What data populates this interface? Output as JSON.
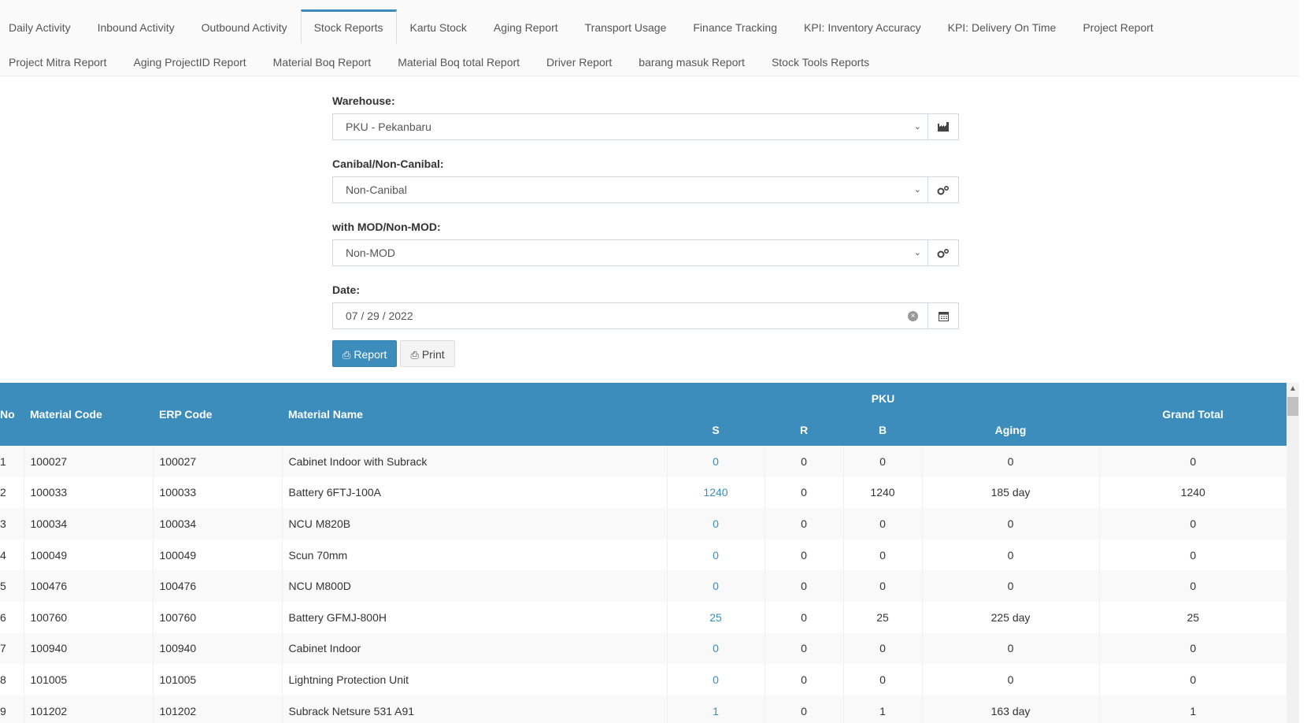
{
  "tabs": {
    "row1": [
      "Daily Activity",
      "Inbound Activity",
      "Outbound Activity",
      "Stock Reports",
      "Kartu Stock",
      "Aging Report",
      "Transport Usage",
      "Finance Tracking",
      "KPI: Inventory Accuracy",
      "KPI: Delivery On Time",
      "Project Report"
    ],
    "row2": [
      "Project Mitra Report",
      "Aging ProjectID Report",
      "Material Boq Report",
      "Material Boq total Report",
      "Driver Report",
      "barang masuk Report",
      "Stock Tools Reports"
    ],
    "active": "Stock Reports"
  },
  "form": {
    "warehouse": {
      "label": "Warehouse:",
      "value": "PKU - Pekanbaru",
      "icon": "industry-icon"
    },
    "canibal": {
      "label": "Canibal/Non-Canibal:",
      "value": "Non-Canibal",
      "icon": "gears-icon"
    },
    "mod": {
      "label": "with MOD/Non-MOD:",
      "value": "Non-MOD",
      "icon": "gears-icon"
    },
    "date": {
      "label": "Date:",
      "value": "07 / 29 / 2022",
      "icon": "calendar-icon"
    },
    "report_label": "Report",
    "print_label": "Print"
  },
  "table": {
    "headers": {
      "no": "No",
      "material_code": "Material Code",
      "erp_code": "ERP Code",
      "material_name": "Material Name",
      "group": "PKU",
      "s": "S",
      "r": "R",
      "b": "B",
      "aging": "Aging",
      "grand_total": "Grand Total"
    },
    "rows": [
      {
        "no": "1",
        "code": "100027",
        "erp": "100027",
        "name": "Cabinet Indoor with Subrack",
        "s": "0",
        "r": "0",
        "b": "0",
        "aging": "0",
        "total": "0"
      },
      {
        "no": "2",
        "code": "100033",
        "erp": "100033",
        "name": "Battery 6FTJ-100A",
        "s": "1240",
        "r": "0",
        "b": "1240",
        "aging": "185 day",
        "total": "1240"
      },
      {
        "no": "3",
        "code": "100034",
        "erp": "100034",
        "name": "NCU M820B",
        "s": "0",
        "r": "0",
        "b": "0",
        "aging": "0",
        "total": "0"
      },
      {
        "no": "4",
        "code": "100049",
        "erp": "100049",
        "name": "Scun 70mm",
        "s": "0",
        "r": "0",
        "b": "0",
        "aging": "0",
        "total": "0"
      },
      {
        "no": "5",
        "code": "100476",
        "erp": "100476",
        "name": "NCU M800D",
        "s": "0",
        "r": "0",
        "b": "0",
        "aging": "0",
        "total": "0"
      },
      {
        "no": "6",
        "code": "100760",
        "erp": "100760",
        "name": "Battery GFMJ-800H",
        "s": "25",
        "r": "0",
        "b": "25",
        "aging": "225 day",
        "total": "25"
      },
      {
        "no": "7",
        "code": "100940",
        "erp": "100940",
        "name": "Cabinet Indoor",
        "s": "0",
        "r": "0",
        "b": "0",
        "aging": "0",
        "total": "0"
      },
      {
        "no": "8",
        "code": "101005",
        "erp": "101005",
        "name": "Lightning Protection Unit",
        "s": "0",
        "r": "0",
        "b": "0",
        "aging": "0",
        "total": "0"
      },
      {
        "no": "9",
        "code": "101202",
        "erp": "101202",
        "name": "Subrack Netsure 531 A91",
        "s": "1",
        "r": "0",
        "b": "1",
        "aging": "163 day",
        "total": "1"
      }
    ]
  }
}
